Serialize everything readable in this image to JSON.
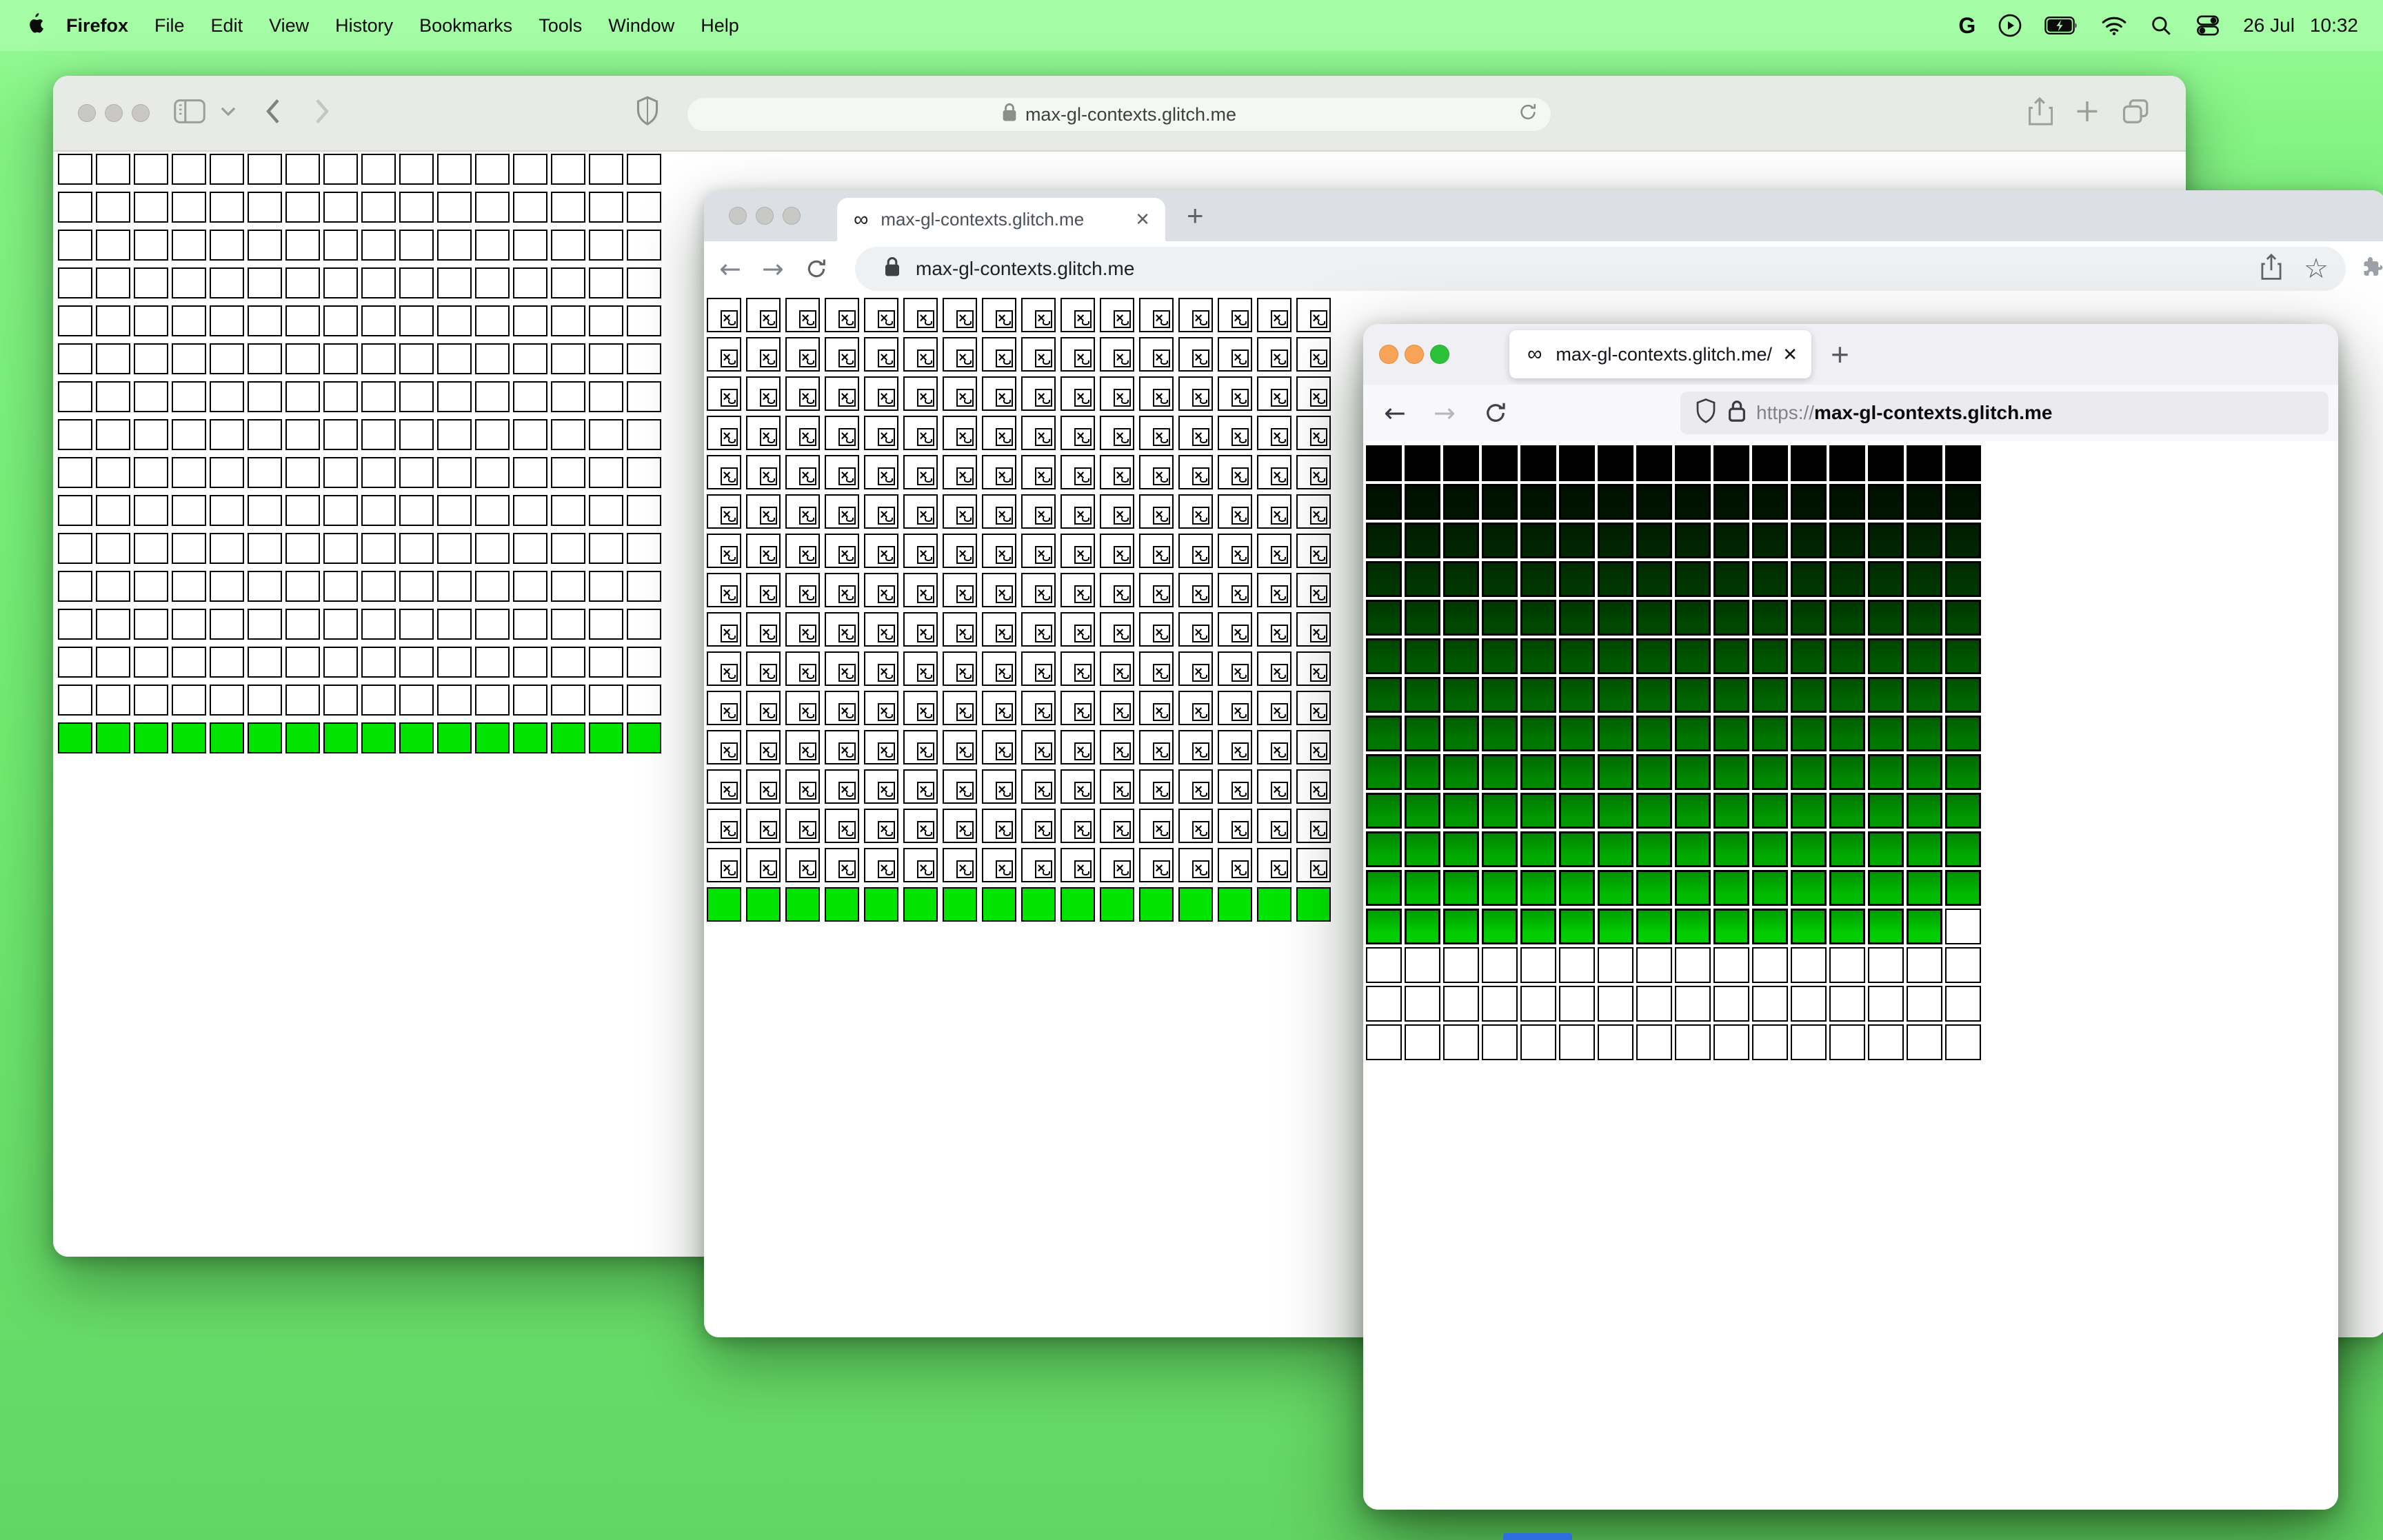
{
  "menu_bar": {
    "app": "Firefox",
    "items": [
      "File",
      "Edit",
      "View",
      "History",
      "Bookmarks",
      "Tools",
      "Window",
      "Help"
    ],
    "status": {
      "google": "G",
      "date": "26 Jul",
      "time": "10:32"
    }
  },
  "page": {
    "site": "max-gl-contexts.glitch.me"
  },
  "safari_window": {
    "url": "max-gl-contexts.glitch.me",
    "traffic_lights": [
      "#c9c8c5",
      "#c9c8c5",
      "#c9c8c5"
    ],
    "grid": {
      "cols": 16,
      "rows": 16,
      "white_rows": 15,
      "cell_fill": "#ffffff",
      "green_row_fill": "#00e400",
      "border_color": "#000000"
    }
  },
  "chrome_window": {
    "tab_favicon": "∞",
    "tab_title": "max-gl-contexts.glitch.me",
    "tab_close": "✕",
    "new_tab": "+",
    "back": "←",
    "forward": "→",
    "url": "max-gl-contexts.glitch.me",
    "bookmark_star": "☆",
    "traffic_lights": [
      "#c8c8c6",
      "#c8c8c6",
      "#c8c8c6"
    ],
    "grid": {
      "cols": 16,
      "rows": 16,
      "broken_rows": 15,
      "broken_glyph": "×",
      "green_row_fill": "#00e400",
      "border_color": "#000000"
    }
  },
  "firefox_window": {
    "tab_favicon": "∞",
    "tab_title": "max-gl-contexts.glitch.me/",
    "tab_close": "✕",
    "new_tab": "+",
    "back": "←",
    "forward": "→",
    "url_scheme": "https://",
    "url_domain": "max-gl-contexts.glitch.me",
    "traffic_lights": [
      "#f8a355",
      "#f8a355",
      "#2bc23a"
    ],
    "grid": {
      "cols": 16,
      "row_colors": [
        "#000000",
        "#001400",
        "#002500",
        "#003600",
        "#004700",
        "#005800",
        "#006600",
        "#007700",
        "#008800",
        "#009900",
        "#00aa00",
        "#00bb00",
        "#00cc00"
      ],
      "missing_cell": {
        "row_index": 12,
        "col_index": 15
      },
      "white_rows": 3
    }
  },
  "desktop": {
    "wallpaper_top": "#9bfc9b",
    "wallpaper_bottom": "#63d563",
    "blue_strip": "#2f6fdd"
  }
}
